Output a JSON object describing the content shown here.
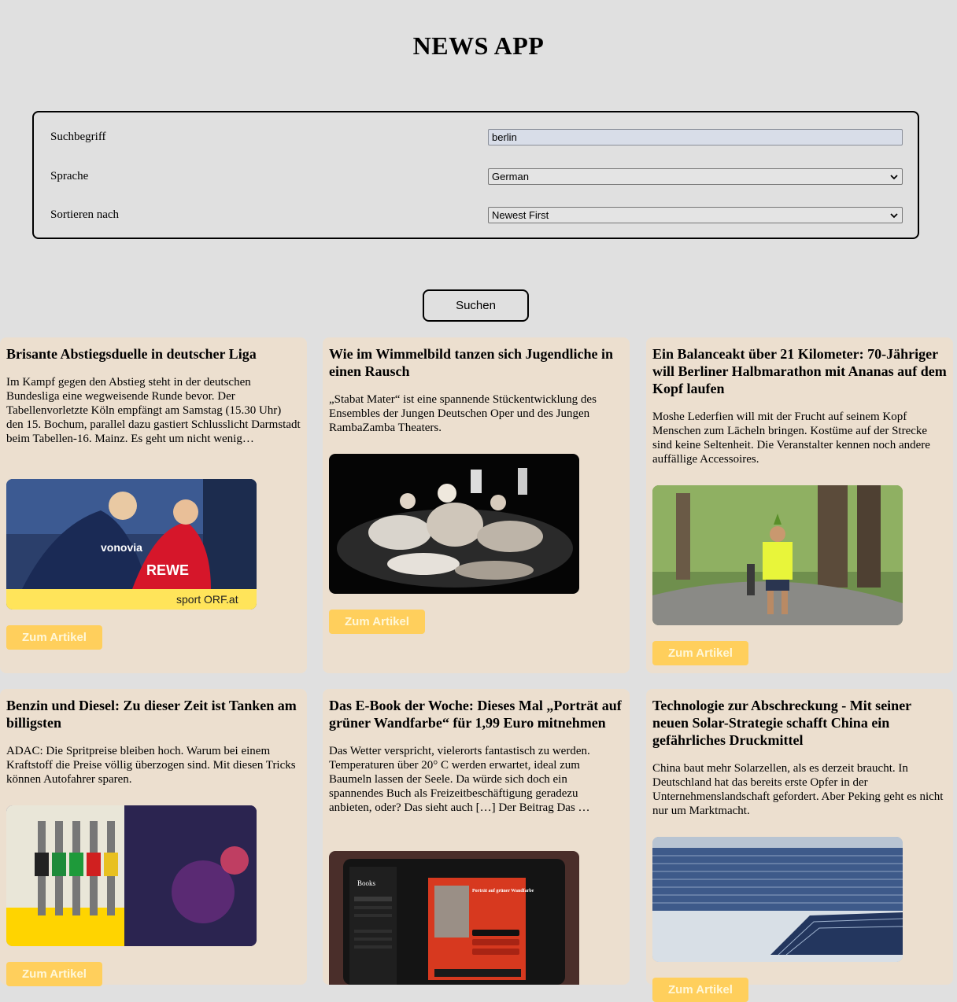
{
  "app": {
    "title": "NEWS APP"
  },
  "search": {
    "term_label": "Suchbegriff",
    "term_value": "berlin",
    "language_label": "Sprache",
    "language_value": "German",
    "sort_label": "Sortieren nach",
    "sort_value": "Newest First",
    "button_label": "Suchen"
  },
  "articles": [
    {
      "title": "Brisante Abstiegsduelle in deutscher Liga",
      "description": "Im Kampf gegen den Abstieg steht in der deutschen Bundesliga eine wegweisende Runde bevor. Der Tabellenvorletzte Köln empfängt am Samstag (15.30 Uhr) den 15. Bochum, parallel dazu gastiert Schlusslicht Darmstadt beim Tabellen-16. Mainz. Es geht um nicht wenig…",
      "image_watermark": "sport ORF.at",
      "shirt_text_1": "vonovia",
      "shirt_text_2": "REWE",
      "button_label": "Zum Artikel"
    },
    {
      "title": "Wie im Wimmelbild tanzen sich Jugendliche in einen Rausch",
      "description": "„Stabat Mater“ ist eine spannende Stückentwicklung des Ensembles der Jungen Deutschen Oper und des Jungen RambaZamba Theaters.",
      "button_label": "Zum Artikel"
    },
    {
      "title": "Ein Balanceakt über 21 Kilometer: 70-Jähriger will Berliner Halbmarathon mit Ananas auf dem Kopf laufen",
      "description": "Moshe Lederfien will mit der Frucht auf seinem Kopf Menschen zum Lächeln bringen. Kostüme auf der Strecke sind keine Seltenheit. Die Veranstalter kennen noch andere auffällige Accessoires.",
      "button_label": "Zum Artikel"
    },
    {
      "title": "Benzin und Diesel: Zu dieser Zeit ist Tanken am billigsten",
      "description": "ADAC: Die Spritpreise bleiben hoch. Warum bei einem Kraftstoff die Preise völlig überzogen sind. Mit diesen Tricks können Autofahrer sparen.",
      "button_label": "Zum Artikel"
    },
    {
      "title": "Das E-Book der Woche: Dieses Mal „Porträt auf grüner Wandfarbe“ für 1,99 Euro mitnehmen",
      "description": "Das Wetter verspricht, vielerorts fantastisch zu werden. Temperaturen über 20° C werden erwartet, ideal zum Baumeln lassen der Seele. Da würde sich doch ein spannendes Buch als Freizeitbeschäftigung geradezu anbieten, oder? Das sieht auch […] Der Beitrag Das …",
      "ebook_sidebar_title": "Books",
      "ebook_book_title": "Porträt auf grüner Wandfarbe",
      "button_label": "Zum Artikel"
    },
    {
      "title": "Technologie zur Abschreckung - Mit seiner neuen Solar-Strategie schafft China ein gefährliches Druckmittel",
      "description": "China baut mehr Solarzellen, als es derzeit braucht. In Deutschland hat das bereits erste Opfer in der Unternehmenslandschaft gefordert. Aber Peking geht es nicht nur um Marktmacht.",
      "button_label": "Zum Artikel"
    }
  ],
  "colors": {
    "page_bg": "#e0e0e0",
    "card_bg": "#ecdfcf",
    "button_bg": "#ffcf5c",
    "button_text": "#fff7d8"
  }
}
